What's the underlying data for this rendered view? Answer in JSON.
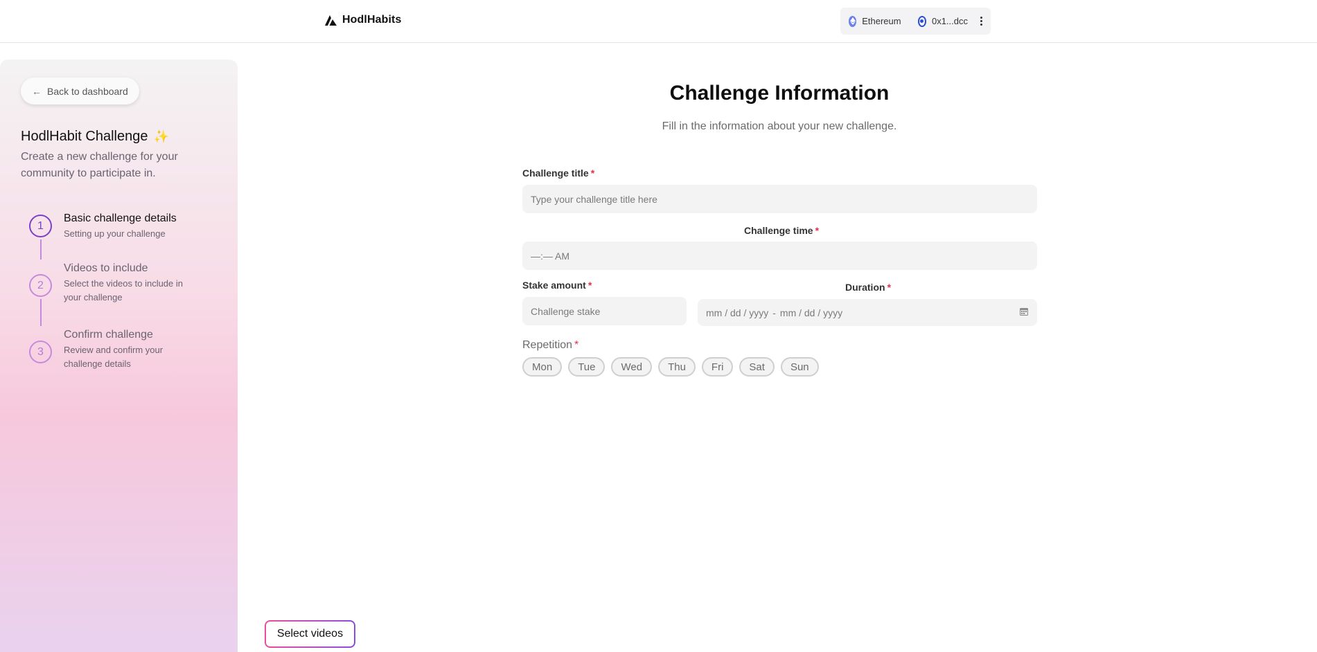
{
  "header": {
    "brand": "HodlHabits",
    "network": "Ethereum",
    "account": "0x1...dcc",
    "icons": [
      "hodlhabits-logo-icon",
      "ethereum-icon",
      "account-icon",
      "more-vertical-icon"
    ]
  },
  "sidebar": {
    "back_label": "Back to dashboard",
    "title": "HodlHabit Challenge",
    "title_emoji": "✨",
    "description": "Create a new challenge for your community to participate in.",
    "steps": [
      {
        "number": "1",
        "title": "Basic challenge details",
        "subtitle": "Setting up your challenge",
        "active": true
      },
      {
        "number": "2",
        "title": "Videos to include",
        "subtitle": "Select the videos to include in your challenge",
        "active": false
      },
      {
        "number": "3",
        "title": "Confirm challenge",
        "subtitle": "Review and confirm your challenge details",
        "active": false
      }
    ]
  },
  "main": {
    "title": "Challenge Information",
    "subtitle": "Fill in the information about your new challenge.",
    "fields": {
      "challenge_title": {
        "label": "Challenge title",
        "placeholder": "Type your challenge title here"
      },
      "challenge_time": {
        "label": "Challenge time",
        "value": "—:— AM"
      },
      "stake_amount": {
        "label": "Stake amount",
        "placeholder": "Challenge stake"
      },
      "duration": {
        "label": "Duration",
        "start": "mm / dd / yyyy",
        "separator": "-",
        "end": "mm / dd / yyyy"
      },
      "required_marker": "*"
    },
    "repetition": {
      "label": "Repetition",
      "days": [
        "Mon",
        "Tue",
        "Wed",
        "Thu",
        "Fri",
        "Sat",
        "Sun"
      ]
    },
    "next_button": "Select videos"
  },
  "colors": {
    "accent": "#7c3fc7",
    "required": "#e0334b",
    "gradient_start": "#ec4d9a",
    "gradient_end": "#8a4be0"
  }
}
